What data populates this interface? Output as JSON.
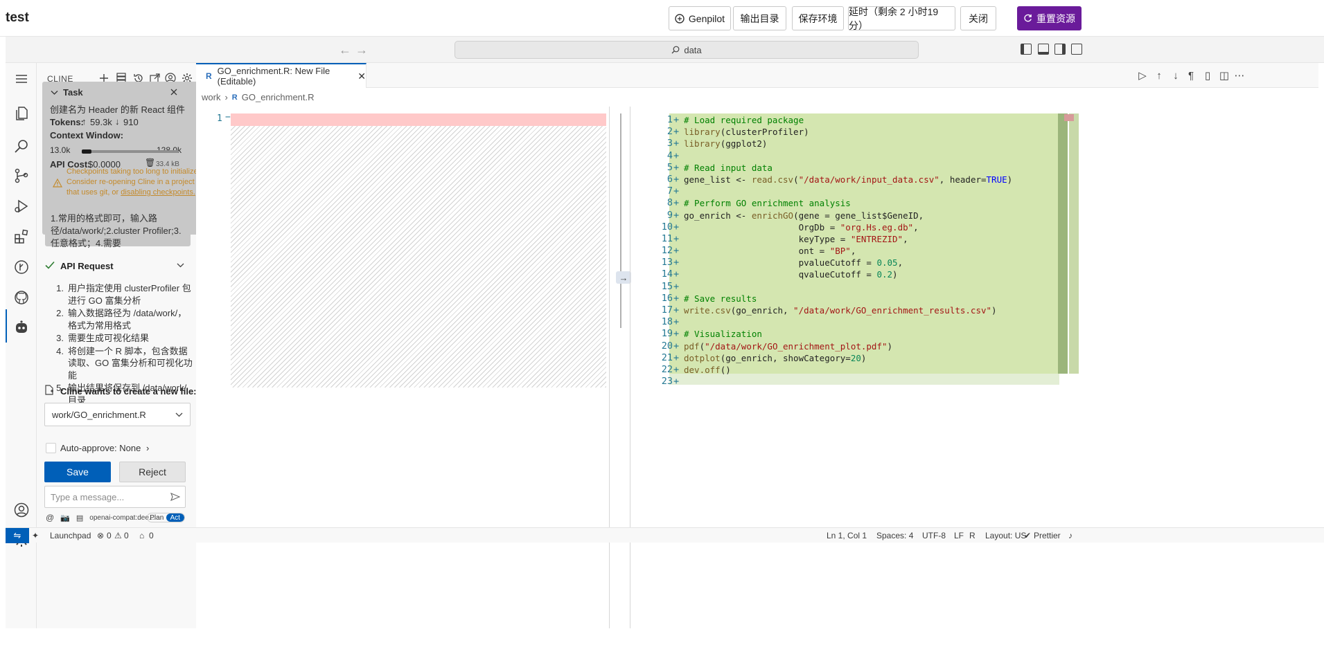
{
  "app": {
    "title": "test",
    "buttons": {
      "genpilot": "Genpilot",
      "output_dir": "输出目录",
      "save_env": "保存环境",
      "extend": "延时（剩余 2 小时19 分）",
      "close": "关闭",
      "reset": "重置资源"
    }
  },
  "titlebar": {
    "search": "data"
  },
  "sidebar": {
    "title": "CLINE",
    "task": {
      "label": "Task",
      "text": "创建名为 Header 的新 React 组件",
      "tokens_label": "Tokens:",
      "tokens_in": "59.3k",
      "tokens_out": "910",
      "context_label": "Context Window:",
      "context_used": "13.0k",
      "context_max": "128.0k",
      "context_fraction": 0.1,
      "api_cost_label": "API Cost:",
      "api_cost": "$0.0000",
      "size": "33.4 kB",
      "warning_pre": "Checkpoints taking too long to initialize. Consider re-opening Cline in a project that uses git, or ",
      "warning_link": "disabling checkpoints."
    },
    "message": "1.常用的格式即可，输入路径/data/work/;2.cluster Profiler;3.任意格式；4.需要",
    "api_request": {
      "label": "API Request",
      "items": [
        "用户指定使用 clusterProfiler 包进行 GO 富集分析",
        "输入数据路径为 /data/work/，格式为常用格式",
        "需要生成可视化结果",
        "将创建一个 R 脚本，包含数据读取、GO 富集分析和可视化功能",
        "输出结果将保存到 /data/work/ 目录"
      ]
    },
    "create_file_label": "Cline wants to create a new file:",
    "file_path": "work/GO_enrichment.R",
    "auto_approve": "Auto-approve: None",
    "save": "Save",
    "reject": "Reject",
    "input_placeholder": "Type a message...",
    "model": "openai-compat:dee...",
    "plan": "Plan",
    "act": "Act"
  },
  "editor": {
    "tab_label": "GO_enrichment.R: New File (Editable)",
    "breadcrumbs": [
      "work",
      "GO_enrichment.R"
    ],
    "left_line": "1",
    "code_lines": [
      "# Load required package",
      "library(clusterProfiler)",
      "library(ggplot2)",
      "",
      "# Read input data",
      "gene_list <- read.csv(\"/data/work/input_data.csv\", header=TRUE)",
      "",
      "# Perform GO enrichment analysis",
      "go_enrich <- enrichGO(gene = gene_list$GeneID,",
      "                      OrgDb = \"org.Hs.eg.db\",",
      "                      keyType = \"ENTREZID\",",
      "                      ont = \"BP\",",
      "                      pvalueCutoff = 0.05,",
      "                      qvalueCutoff = 0.2)",
      "",
      "# Save results",
      "write.csv(go_enrich, \"/data/work/GO_enrichment_results.csv\")",
      "",
      "# Visualization",
      "pdf(\"/data/work/GO_enrichment_plot.pdf\")",
      "dotplot(go_enrich, showCategory=20)",
      "dev.off()",
      ""
    ]
  },
  "statusbar": {
    "launchpad": "Launchpad",
    "errors": "0",
    "warnings": "0",
    "ports": "0",
    "position": "Ln 1, Col 1",
    "spaces": "Spaces: 4",
    "encoding": "UTF-8",
    "eol": "LF",
    "language": "R",
    "layout": "Layout: US",
    "prettier": "Prettier"
  },
  "colors": {
    "accent": "#005fb8",
    "reset_button": "#6a1b9a",
    "added_line": "#d4e6b0",
    "removed_line": "#ffc9c9",
    "warning": "#c48a2b"
  }
}
